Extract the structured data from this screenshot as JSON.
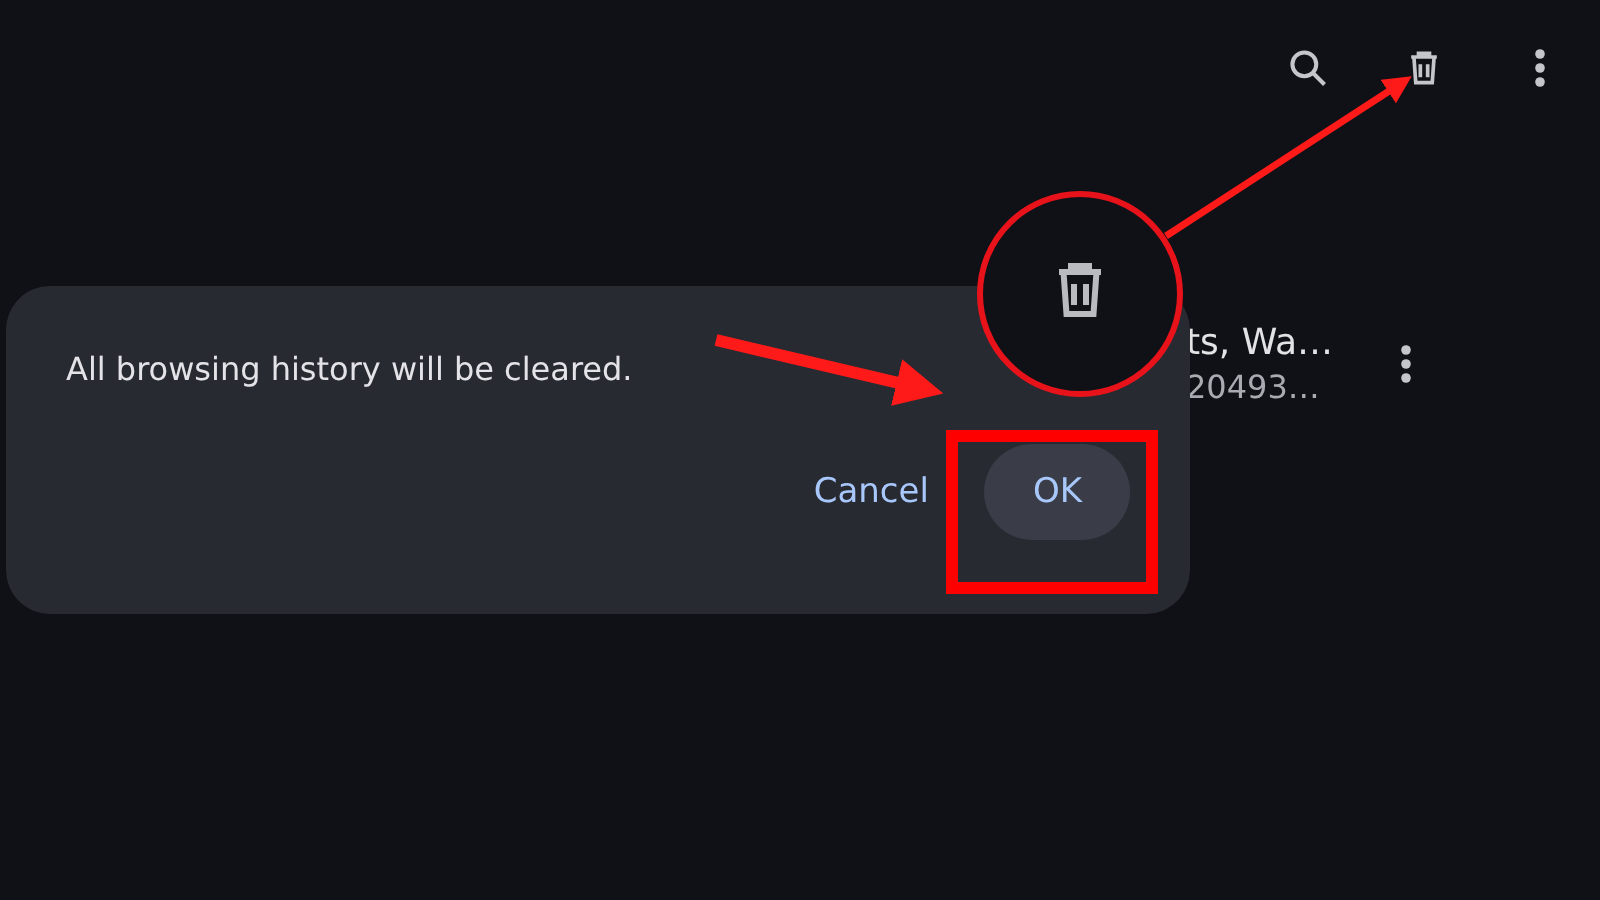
{
  "history_item": {
    "title": "ts, Wa…",
    "subtitle": "20493…"
  },
  "dialog": {
    "message": "All browsing history will be cleared.",
    "buttons": [
      {
        "label": "Cancel",
        "kind": "text"
      },
      {
        "label": "OK",
        "kind": "filled"
      }
    ]
  }
}
